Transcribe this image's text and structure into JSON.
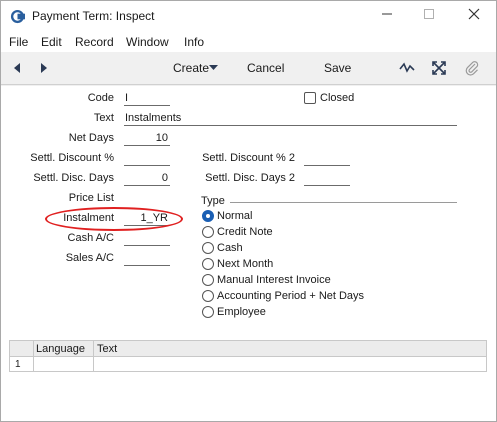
{
  "window": {
    "title": "Payment Term: Inspect"
  },
  "menu": [
    "File",
    "Edit",
    "Record",
    "Window",
    "Info"
  ],
  "toolbar": {
    "create": "Create",
    "cancel": "Cancel",
    "save": "Save"
  },
  "form": {
    "code_label": "Code",
    "code_value": "I",
    "closed_label": "Closed",
    "closed_checked": false,
    "text_label": "Text",
    "text_value": "Instalments",
    "net_days_label": "Net Days",
    "net_days_value": "10",
    "settl_discount_label": "Settl. Discount %",
    "settl_discount_value": "",
    "settl_discount2_label": "Settl. Discount % 2",
    "settl_discount2_value": "",
    "settl_disc_days_label": "Settl. Disc. Days",
    "settl_disc_days_value": "0",
    "settl_disc_days2_label": "Settl. Disc. Days 2",
    "settl_disc_days2_value": "",
    "price_list_label": "Price List",
    "price_list_value": "",
    "instalment_label": "Instalment",
    "instalment_value": "1_YR",
    "cash_ac_label": "Cash A/C",
    "cash_ac_value": "",
    "sales_ac_label": "Sales A/C",
    "sales_ac_value": "",
    "type_label": "Type",
    "type_options": [
      "Normal",
      "Credit Note",
      "Cash",
      "Next Month",
      "Manual Interest Invoice",
      "Accounting Period + Net Days",
      "Employee"
    ],
    "type_selected": "Normal"
  },
  "grid": {
    "columns": [
      "Language",
      "Text"
    ],
    "rows": [
      {
        "num": "1",
        "language": "",
        "text": ""
      }
    ]
  },
  "colors": {
    "accent": "#1a5fb4",
    "highlight": "#e02020"
  }
}
